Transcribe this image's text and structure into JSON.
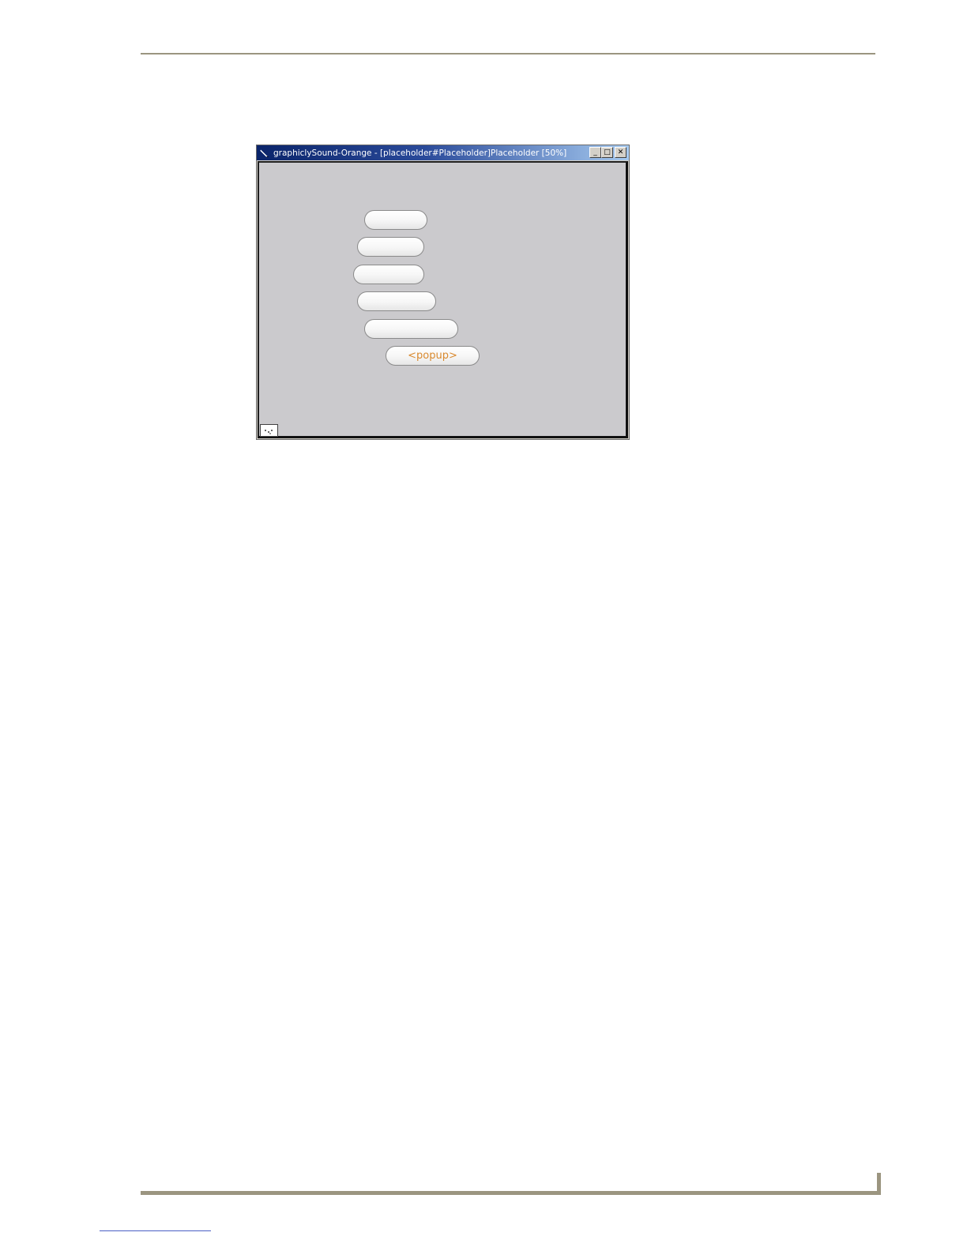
{
  "window": {
    "title": "graphiclySound-Orange - [placeholder#Placeholder]Placeholder  [50%]",
    "caption_buttons": {
      "minimize_glyph": "_",
      "maximize_glyph": "□",
      "close_glyph": "✕"
    }
  },
  "canvas": {
    "buttons": [
      {
        "label": ""
      },
      {
        "label": ""
      },
      {
        "label": ""
      },
      {
        "label": ""
      },
      {
        "label": ""
      },
      {
        "label": "<popup>"
      }
    ]
  },
  "colors": {
    "rule": "#9b9580",
    "popup_text": "#d9892e",
    "canvas_bg": "#cbcacd"
  },
  "icons": {
    "app": "app-pen-icon",
    "corner": "page-thumbnail-icon"
  }
}
